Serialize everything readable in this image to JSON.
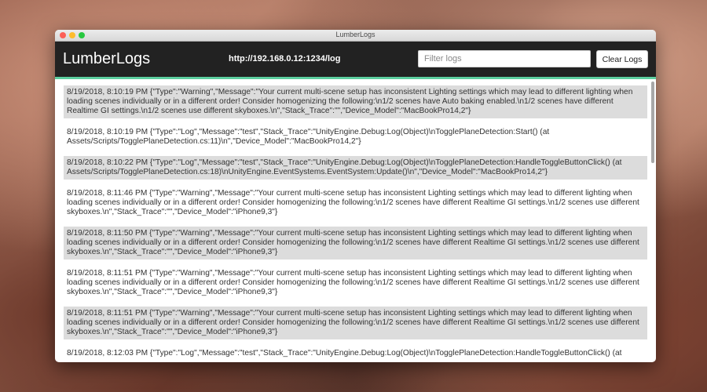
{
  "window": {
    "title": "LumberLogs"
  },
  "header": {
    "brand": "LumberLogs",
    "url": "http://192.168.0.12:1234/log",
    "filter_placeholder": "Filter logs",
    "filter_value": "",
    "clear_label": "Clear Logs"
  },
  "colors": {
    "header_bg": "#222222",
    "accent": "#5ccf9f",
    "row_shade": "#dcdcdc"
  },
  "logs": [
    {
      "shaded": true,
      "text": "8/19/2018, 8:10:19 PM {\"Type\":\"Warning\",\"Message\":\"Your current multi-scene setup has inconsistent Lighting settings which may lead to different lighting when loading scenes individually or in a different order! Consider homogenizing the following:\\n1/2 scenes have Auto baking enabled.\\n1/2 scenes have different Realtime GI settings.\\n1/2 scenes use different skyboxes.\\n\",\"Stack_Trace\":\"\",\"Device_Model\":\"MacBookPro14,2\"}"
    },
    {
      "shaded": false,
      "text": "8/19/2018, 8:10:19 PM {\"Type\":\"Log\",\"Message\":\"test\",\"Stack_Trace\":\"UnityEngine.Debug:Log(Object)\\nTogglePlaneDetection:Start() (at Assets/Scripts/TogglePlaneDetection.cs:11)\\n\",\"Device_Model\":\"MacBookPro14,2\"}"
    },
    {
      "shaded": true,
      "text": "8/19/2018, 8:10:22 PM {\"Type\":\"Log\",\"Message\":\"test\",\"Stack_Trace\":\"UnityEngine.Debug:Log(Object)\\nTogglePlaneDetection:HandleToggleButtonClick() (at Assets/Scripts/TogglePlaneDetection.cs:18)\\nUnityEngine.EventSystems.EventSystem:Update()\\n\",\"Device_Model\":\"MacBookPro14,2\"}"
    },
    {
      "shaded": false,
      "text": "8/19/2018, 8:11:46 PM {\"Type\":\"Warning\",\"Message\":\"Your current multi-scene setup has inconsistent Lighting settings which may lead to different lighting when loading scenes individually or in a different order! Consider homogenizing the following:\\n1/2 scenes have different Realtime GI settings.\\n1/2 scenes use different skyboxes.\\n\",\"Stack_Trace\":\"\",\"Device_Model\":\"iPhone9,3\"}"
    },
    {
      "shaded": true,
      "text": "8/19/2018, 8:11:50 PM {\"Type\":\"Warning\",\"Message\":\"Your current multi-scene setup has inconsistent Lighting settings which may lead to different lighting when loading scenes individually or in a different order! Consider homogenizing the following:\\n1/2 scenes have different Realtime GI settings.\\n1/2 scenes use different skyboxes.\\n\",\"Stack_Trace\":\"\",\"Device_Model\":\"iPhone9,3\"}"
    },
    {
      "shaded": false,
      "text": "8/19/2018, 8:11:51 PM {\"Type\":\"Warning\",\"Message\":\"Your current multi-scene setup has inconsistent Lighting settings which may lead to different lighting when loading scenes individually or in a different order! Consider homogenizing the following:\\n1/2 scenes have different Realtime GI settings.\\n1/2 scenes use different skyboxes.\\n\",\"Stack_Trace\":\"\",\"Device_Model\":\"iPhone9,3\"}"
    },
    {
      "shaded": true,
      "text": "8/19/2018, 8:11:51 PM {\"Type\":\"Warning\",\"Message\":\"Your current multi-scene setup has inconsistent Lighting settings which may lead to different lighting when loading scenes individually or in a different order! Consider homogenizing the following:\\n1/2 scenes have different Realtime GI settings.\\n1/2 scenes use different skyboxes.\\n\",\"Stack_Trace\":\"\",\"Device_Model\":\"iPhone9,3\"}"
    },
    {
      "shaded": false,
      "text": "8/19/2018, 8:12:03 PM {\"Type\":\"Log\",\"Message\":\"test\",\"Stack_Trace\":\"UnityEngine.Debug:Log(Object)\\nTogglePlaneDetection:HandleToggleButtonClick() (at"
    }
  ]
}
